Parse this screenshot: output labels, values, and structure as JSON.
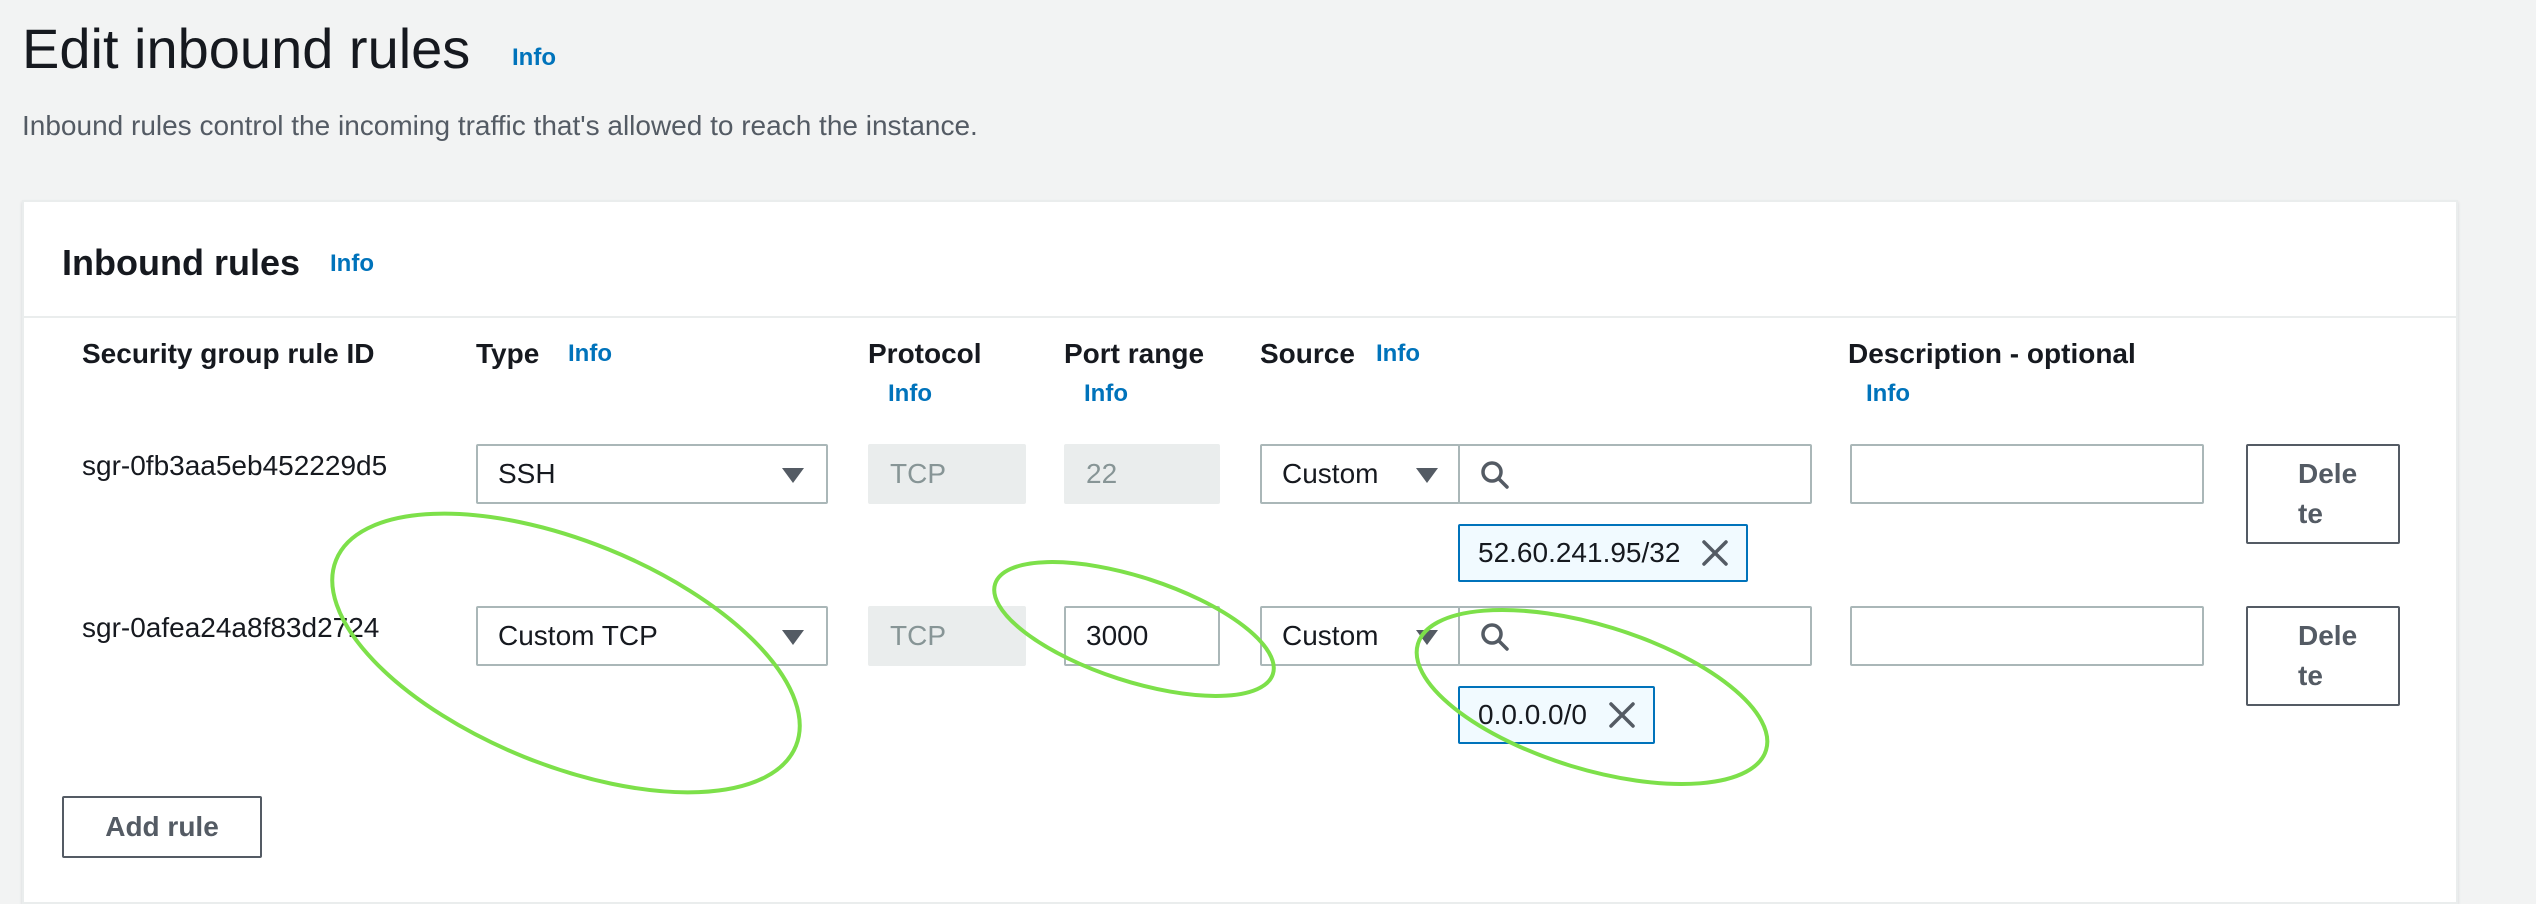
{
  "page": {
    "title": "Edit inbound rules",
    "title_info": "Info",
    "description": "Inbound rules control the incoming traffic that's allowed to reach the instance."
  },
  "panel": {
    "title": "Inbound rules",
    "title_info": "Info"
  },
  "columns": {
    "rule_id": "Security group rule ID",
    "type": "Type",
    "type_info": "Info",
    "protocol": "Protocol",
    "protocol_info": "Info",
    "port_range": "Port range",
    "port_range_info": "Info",
    "source": "Source",
    "source_info": "Info",
    "description": "Description - optional",
    "description_info": "Info"
  },
  "rules": [
    {
      "rule_id": "sgr-0fb3aa5eb452229d5",
      "type": "SSH",
      "protocol": "TCP",
      "port_range": "22",
      "source_type": "Custom",
      "source_search": "",
      "source_token": "52.60.241.95/32",
      "description": "",
      "delete_label": "Delete"
    },
    {
      "rule_id": "sgr-0afea24a8f83d2724",
      "type": "Custom TCP",
      "protocol": "TCP",
      "port_range": "3000",
      "source_type": "Custom",
      "source_search": "",
      "source_token": "0.0.0.0/0",
      "description": "",
      "delete_label": "Delete"
    }
  ],
  "add_rule_label": "Add rule",
  "colors": {
    "link": "#0073bb",
    "annotation": "#7de04a",
    "token_border": "#0073bb",
    "token_bg": "#f1faff"
  },
  "icons": {
    "caret": "caret-down-icon",
    "search": "search-icon",
    "remove": "close-icon"
  }
}
